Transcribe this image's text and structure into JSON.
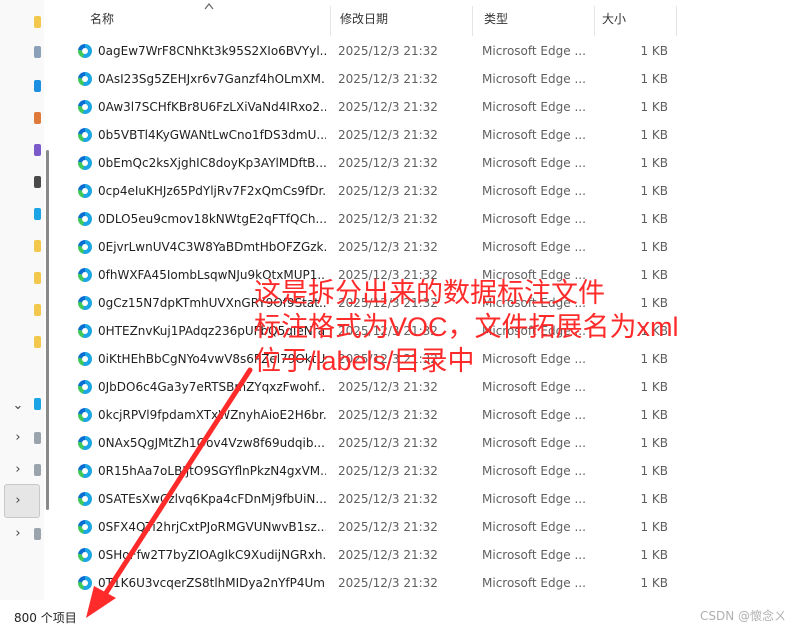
{
  "columns": {
    "name": "名称",
    "date": "修改日期",
    "type": "类型",
    "size": "大小"
  },
  "files": [
    {
      "name": "0agEw7WrF8CNhKt3k95S2XIo6BVYyl...",
      "date": "2025/12/3 21:32",
      "type": "Microsoft Edge ...",
      "size": "1 KB"
    },
    {
      "name": "0AsI23Sg5ZEHJxr6v7Ganzf4hOLmXM...",
      "date": "2025/12/3 21:32",
      "type": "Microsoft Edge ...",
      "size": "1 KB"
    },
    {
      "name": "0Aw3l7SCHfKBr8U6FzLXiVaNd4IRxo2...",
      "date": "2025/12/3 21:32",
      "type": "Microsoft Edge ...",
      "size": "1 KB"
    },
    {
      "name": "0b5VBTl4KyGWANtLwCno1fDS3dmU...",
      "date": "2025/12/3 21:32",
      "type": "Microsoft Edge ...",
      "size": "1 KB"
    },
    {
      "name": "0bEmQc2ksXjghIC8doyKp3AYlMDftB...",
      "date": "2025/12/3 21:32",
      "type": "Microsoft Edge ...",
      "size": "1 KB"
    },
    {
      "name": "0cp4eIuKHJz65PdYljRv7F2xQmCs9fDr...",
      "date": "2025/12/3 21:32",
      "type": "Microsoft Edge ...",
      "size": "1 KB"
    },
    {
      "name": "0DLO5eu9cmov18kNWtgE2qFTfQCh...",
      "date": "2025/12/3 21:32",
      "type": "Microsoft Edge ...",
      "size": "1 KB"
    },
    {
      "name": "0EjvrLwnUV4C3W8YaBDmtHbOFZGzk...",
      "date": "2025/12/3 21:32",
      "type": "Microsoft Edge ...",
      "size": "1 KB"
    },
    {
      "name": "0fhWXFA45IombLsqwNJu9kOtxMUP1...",
      "date": "2025/12/3 21:32",
      "type": "Microsoft Edge ...",
      "size": "1 KB"
    },
    {
      "name": "0gCz15N7dpKTmhUVXnGRY9Of9Stat...",
      "date": "2025/12/3 21:32",
      "type": "Microsoft Edge ...",
      "size": "1 KB"
    },
    {
      "name": "0HTEZnvKuj1PAdqz236pUFbQ5qIeNra...",
      "date": "2025/12/3 21:32",
      "type": "Microsoft Edge ...",
      "size": "1 KB"
    },
    {
      "name": "0iKtHEhBbCgNYo4vwV8s6PZel79OktU...",
      "date": "2025/12/3 21:32",
      "type": "Microsoft Edge ...",
      "size": "1 KB"
    },
    {
      "name": "0JbDO6c4Ga3y7eRTSBmZYqxzFwohf...",
      "date": "2025/12/3 21:32",
      "type": "Microsoft Edge ...",
      "size": "1 KB"
    },
    {
      "name": "0kcjRPVl9fpdamXTxWZnyhAioE2H6br...",
      "date": "2025/12/3 21:32",
      "type": "Microsoft Edge ...",
      "size": "1 KB"
    },
    {
      "name": "0NAx5QgJMtZh1Oov4Vzw8f69udqib...",
      "date": "2025/12/3 21:32",
      "type": "Microsoft Edge ...",
      "size": "1 KB"
    },
    {
      "name": "0R15hAa7oLBIjtO9SGYflnPkzN4gxVM...",
      "date": "2025/12/3 21:32",
      "type": "Microsoft Edge ...",
      "size": "1 KB"
    },
    {
      "name": "0SATEsXwCzlvq6Kpa4cFDnMj9fbUiN...",
      "date": "2025/12/3 21:32",
      "type": "Microsoft Edge ...",
      "size": "1 KB"
    },
    {
      "name": "0SFX4QTi2hrjCxtPJoRMGVUNwvB1sz...",
      "date": "2025/12/3 21:32",
      "type": "Microsoft Edge ...",
      "size": "1 KB"
    },
    {
      "name": "0SHoFfw2T7byZIOAgIkC9XudijNGRxh...",
      "date": "2025/12/3 21:32",
      "type": "Microsoft Edge ...",
      "size": "1 KB"
    },
    {
      "name": "0T1K6U3vcqerZS8tlhMIDya2nYfP4Um...",
      "date": "2025/12/3 21:32",
      "type": "Microsoft Edge ...",
      "size": "1 KB"
    }
  ],
  "status": {
    "item_count": "800 个项目"
  },
  "annotation": {
    "line1": "这是拆分出来的数据标注文件",
    "line2": "标注格式为VOC，文件拓展名为xml",
    "line3": "位于/labels/目录中",
    "color": "#ff2b2b"
  },
  "watermark": "CSDN @懷念ㄨ",
  "icons": {
    "file_icon": "edge-file-icon",
    "sort": "sort-ascending-icon"
  }
}
